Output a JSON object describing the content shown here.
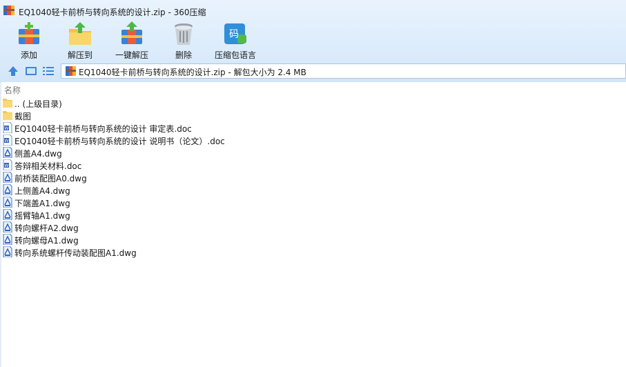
{
  "window": {
    "title": "EQ1040轻卡前桥与转向系统的设计.zip - 360压缩"
  },
  "toolbar": {
    "buttons": [
      {
        "label": "添加",
        "icon": "add-archive-icon"
      },
      {
        "label": "解压到",
        "icon": "extract-to-icon"
      },
      {
        "label": "一键解压",
        "icon": "one-click-extract-icon"
      },
      {
        "label": "删除",
        "icon": "trash-bin-icon"
      },
      {
        "label": "压缩包语言",
        "icon": "archive-language-icon",
        "icon_text": "码"
      }
    ]
  },
  "address": {
    "text": "EQ1040轻卡前桥与转向系统的设计.zip - 解包大小为 2.4 MB"
  },
  "list": {
    "header_name": "名称",
    "items": [
      {
        "name": ".. (上级目录)",
        "type": "folder"
      },
      {
        "name": "截图",
        "type": "folder"
      },
      {
        "name": "EQ1040轻卡前桥与转向系统的设计 审定表.doc",
        "type": "doc"
      },
      {
        "name": "EQ1040轻卡前桥与转向系统的设计 说明书（论文）.doc",
        "type": "doc"
      },
      {
        "name": "侧盖A4.dwg",
        "type": "dwg"
      },
      {
        "name": "答辩相关材料.doc",
        "type": "doc"
      },
      {
        "name": "前桥装配图A0.dwg",
        "type": "dwg"
      },
      {
        "name": "上侧盖A4.dwg",
        "type": "dwg"
      },
      {
        "name": "下端盖A1.dwg",
        "type": "dwg"
      },
      {
        "name": "摇臂轴A1.dwg",
        "type": "dwg"
      },
      {
        "name": "转向螺杆A2.dwg",
        "type": "dwg"
      },
      {
        "name": "转向螺母A1.dwg",
        "type": "dwg"
      },
      {
        "name": "转向系统螺杆传动装配图A1.dwg",
        "type": "dwg"
      }
    ]
  },
  "colors": {
    "accent": "#2f7fd6",
    "folder": "#f5c84c",
    "chrome": "#dcecfb"
  }
}
